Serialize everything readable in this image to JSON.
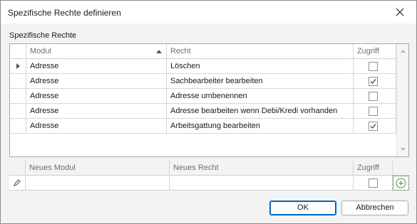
{
  "window": {
    "title": "Spezifische Rechte definieren"
  },
  "section_label": "Spezifische Rechte",
  "grid": {
    "columns": [
      "Modul",
      "Recht",
      "Zugriff"
    ],
    "sorted_column": "Modul",
    "rows": [
      {
        "modul": "Adresse",
        "recht": "Löschen",
        "zugriff": false,
        "current": true
      },
      {
        "modul": "Adresse",
        "recht": "Sachbearbeiter bearbeiten",
        "zugriff": true,
        "current": false
      },
      {
        "modul": "Adresse",
        "recht": "Adresse umbenennen",
        "zugriff": false,
        "current": false
      },
      {
        "modul": "Adresse",
        "recht": "Adresse bearbeiten wenn Debi/Kredi vorhanden",
        "zugriff": false,
        "current": false
      },
      {
        "modul": "Adresse",
        "recht": "Arbeitsgattung bearbeiten",
        "zugriff": true,
        "current": false
      }
    ]
  },
  "new_row": {
    "columns": [
      "Neues Modul",
      "Neues Recht",
      "Zugriff"
    ],
    "modul_value": "",
    "recht_value": "",
    "zugriff": false
  },
  "buttons": {
    "ok": "OK",
    "cancel": "Abbrechen"
  },
  "colors": {
    "accent": "#0067c0",
    "add_icon": "#3c9a3c"
  }
}
